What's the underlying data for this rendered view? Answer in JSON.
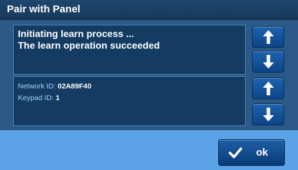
{
  "window": {
    "title": "Pair with Panel"
  },
  "log": {
    "lines": [
      "Initiating learn process ...",
      "The learn operation succeeded"
    ]
  },
  "info": {
    "network_label": "Network ID:",
    "network_value": "02A89F40",
    "keypad_label": "Keypad ID:",
    "keypad_value": "1"
  },
  "buttons": {
    "ok_label": "ok",
    "ok_icon": "checkmark-icon",
    "scroll_up_icon": "arrow-up-icon",
    "scroll_down_icon": "arrow-down-icon"
  },
  "colors": {
    "title_bar": "#1f466e",
    "panel": "#143c63",
    "button": "#1c63ad",
    "background": "#5aa3e6"
  }
}
